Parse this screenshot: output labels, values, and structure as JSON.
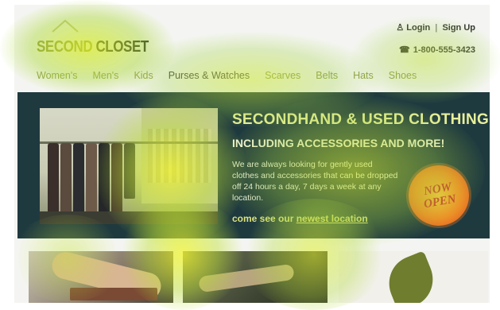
{
  "brand": {
    "logo_word1": "SECOND",
    "logo_word2": "CLOSET"
  },
  "account": {
    "login_label": "Login",
    "signup_label": "Sign Up",
    "separator": "|"
  },
  "contact": {
    "phone": "1-800-555-3423"
  },
  "nav": {
    "items": [
      {
        "label": "Women's"
      },
      {
        "label": "Men's"
      },
      {
        "label": "Kids"
      },
      {
        "label": "Purses & Watches"
      },
      {
        "label": "Scarves"
      },
      {
        "label": "Belts"
      },
      {
        "label": "Hats"
      },
      {
        "label": "Shoes"
      }
    ]
  },
  "banner": {
    "title": "SECONDHAND & USED CLOTHING",
    "subtitle": "INCLUDING ACCESSORIES AND MORE!",
    "body": "We are always looking for gently used clothes and accessories that can be dropped off 24 hours a day, 7 days a week at any location.",
    "cta_prefix": "come see our ",
    "cta_link": "newest location",
    "badge_line1": "NOW",
    "badge_line2": "OPEN"
  },
  "icons": {
    "login": "person-icon",
    "phone": "phone-icon",
    "logo": "house-logo-icon"
  },
  "colors": {
    "banner_bg": "#1f3a3f",
    "title_green": "#e7ef9a",
    "nav_green": "#8f9a4a",
    "badge_orange": "#ef8a25",
    "heat_yellow": "#e8f03a",
    "heat_green": "#a9d23a"
  }
}
